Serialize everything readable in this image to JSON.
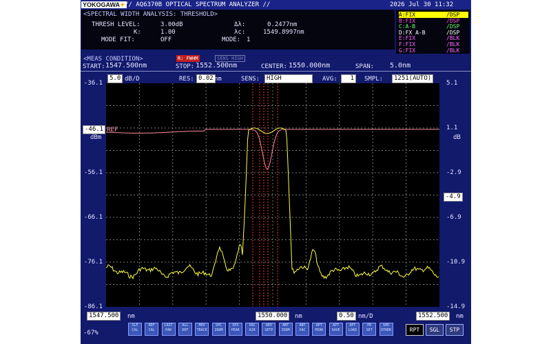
{
  "header": {
    "brand": "YOKOGAWA",
    "model": "// AQ6370B OPTICAL SPECTRUM ANALYZER //",
    "datetime": "2026 Jul 30 11:32"
  },
  "analysis": {
    "title": "<SPECTRAL WIDTH ANALYSIS: THRESHOLD>",
    "thresh_label": "THRESH LEVEL:",
    "thresh_value": "3.00dB",
    "k_label": "K:",
    "k_value": "1.00",
    "modefit_label": "MODE FIT:",
    "modefit_value": "OFF",
    "dl_label": "Δλ:",
    "dl_value": "0.2477nm",
    "lc_label": "λc:",
    "lc_value": "1549.8997nm",
    "mode_label": "MODE:",
    "mode_value": "1"
  },
  "traces": [
    {
      "name": "A:FIX",
      "state": "/DSP",
      "color": "#000000",
      "bg": "#ffff00"
    },
    {
      "name": "B:FIX",
      "state": "/DSP",
      "color": "#ff55cc",
      "bg": ""
    },
    {
      "name": "C:A-B",
      "state": "/DSP",
      "color": "#66ff66",
      "bg": ""
    },
    {
      "name": "D:FX A-B",
      "state": "/DSP",
      "color": "#ffffff",
      "bg": ""
    },
    {
      "name": "E:FIX",
      "state": "/BLK",
      "color": "#ff66ff",
      "bg": ""
    },
    {
      "name": "F:FIX",
      "state": "/BLK",
      "color": "#ff66ff",
      "bg": ""
    },
    {
      "name": "G:FIX",
      "state": "/BLK",
      "color": "#ff66ff",
      "bg": ""
    }
  ],
  "meas": {
    "title": "<MEAS CONDITION>",
    "badge1": "R: FWHM",
    "badge2": "SENS HIGH",
    "start_label": "START:",
    "start_value": "1547.500nm",
    "stop_label": "STOP:",
    "stop_value": "1552.500nm",
    "center_label": "CENTER:",
    "center_value": "1550.000nm",
    "span_label": "SPAN:",
    "span_value": "5.0nm"
  },
  "controls": {
    "scale_value": "5.0",
    "scale_unit": "dB/D",
    "res_label": "RES:",
    "res_value": "0.02",
    "res_unit": "nm",
    "sens_label": "SENS:",
    "sens_value": "HIGH",
    "avg_label": "AVG:",
    "avg_value": "1",
    "smpl_label": "SMPL:",
    "smpl_value": "1251(AUTO)"
  },
  "yaxis_left": {
    "ticks": [
      "-36.1",
      "-46.1",
      "-56.1",
      "-66.1",
      "-76.1",
      "-86.1"
    ],
    "unit": "dBm"
  },
  "yaxis_right": {
    "ticks": [
      "5.1",
      "1.1",
      "-2.9",
      "-6.9",
      "-10.9",
      "-14.9"
    ],
    "unit": "dB",
    "marker": "-4.9"
  },
  "ref_label": "REF",
  "xaxis": {
    "start": "1547.500",
    "start_unit": "nm",
    "center": "1550.000",
    "center_unit": "nm",
    "span_per_div": "0.50",
    "span_unit": "nm/D",
    "stop": "1552.500",
    "stop_unit": "nm"
  },
  "toolbar": {
    "zoom": "-67%",
    "buttons": [
      "SLF CAL",
      "REF CAL",
      "LAST PAR",
      "ALL DEF",
      "MOV TRACE",
      "SPC ZOOM",
      "SPX PEAK",
      "VAC AIR",
      "ADV SETP",
      "ANT ZOOM",
      "ANT VAC",
      "APT PEAK",
      "APT SAVE",
      "APT LOAD",
      "PR SET",
      "SHO OTHER"
    ],
    "rpt": "RPT",
    "sgl": "SGL",
    "stp": "STP"
  }
}
